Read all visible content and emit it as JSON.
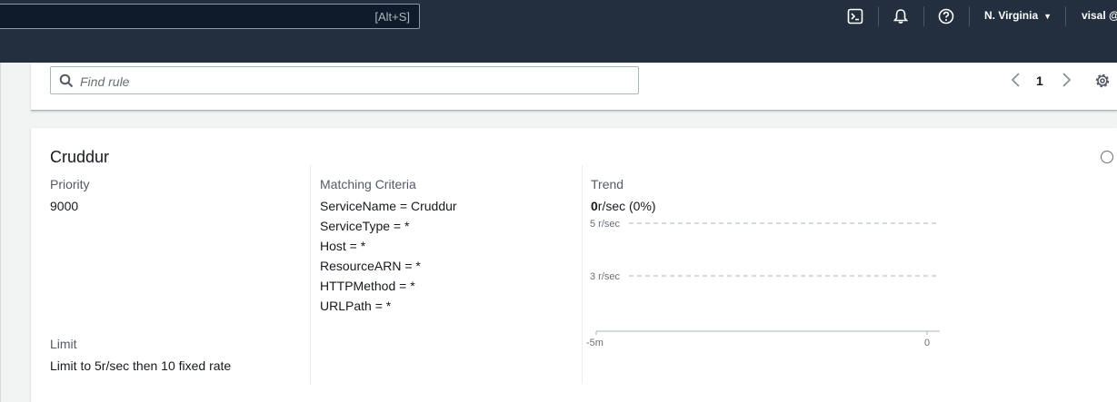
{
  "topnav": {
    "search_shortcut": "[Alt+S]",
    "icons": [
      "cloudshell-icon",
      "bell-icon",
      "help-icon"
    ],
    "region": "N. Virginia",
    "user": "visal @"
  },
  "toolbar": {
    "find_placeholder": "Find rule",
    "page_number": "1"
  },
  "rule": {
    "name": "Cruddur",
    "priority_label": "Priority",
    "priority_value": "9000",
    "limit_label": "Limit",
    "limit_value": "Limit to 5r/sec then 10 fixed rate",
    "criteria_label": "Matching Criteria",
    "criteria": [
      "ServiceName = Cruddur",
      "ServiceType = *",
      "Host = *",
      "ResourceARN = *",
      "HTTPMethod = *",
      "URLPath = *"
    ],
    "trend_label": "Trend",
    "trend_rate_value": "0",
    "trend_rate_rest": "r/sec (0%)"
  },
  "chart_data": {
    "type": "line",
    "xlabel": "",
    "ylabel": "",
    "x_ticks": [
      "-5m",
      "0"
    ],
    "reference_lines": [
      {
        "label": "5 r/sec",
        "value": 5
      },
      {
        "label": "3 r/sec",
        "value": 3
      }
    ],
    "series": [],
    "ylim": [
      0,
      5
    ]
  }
}
